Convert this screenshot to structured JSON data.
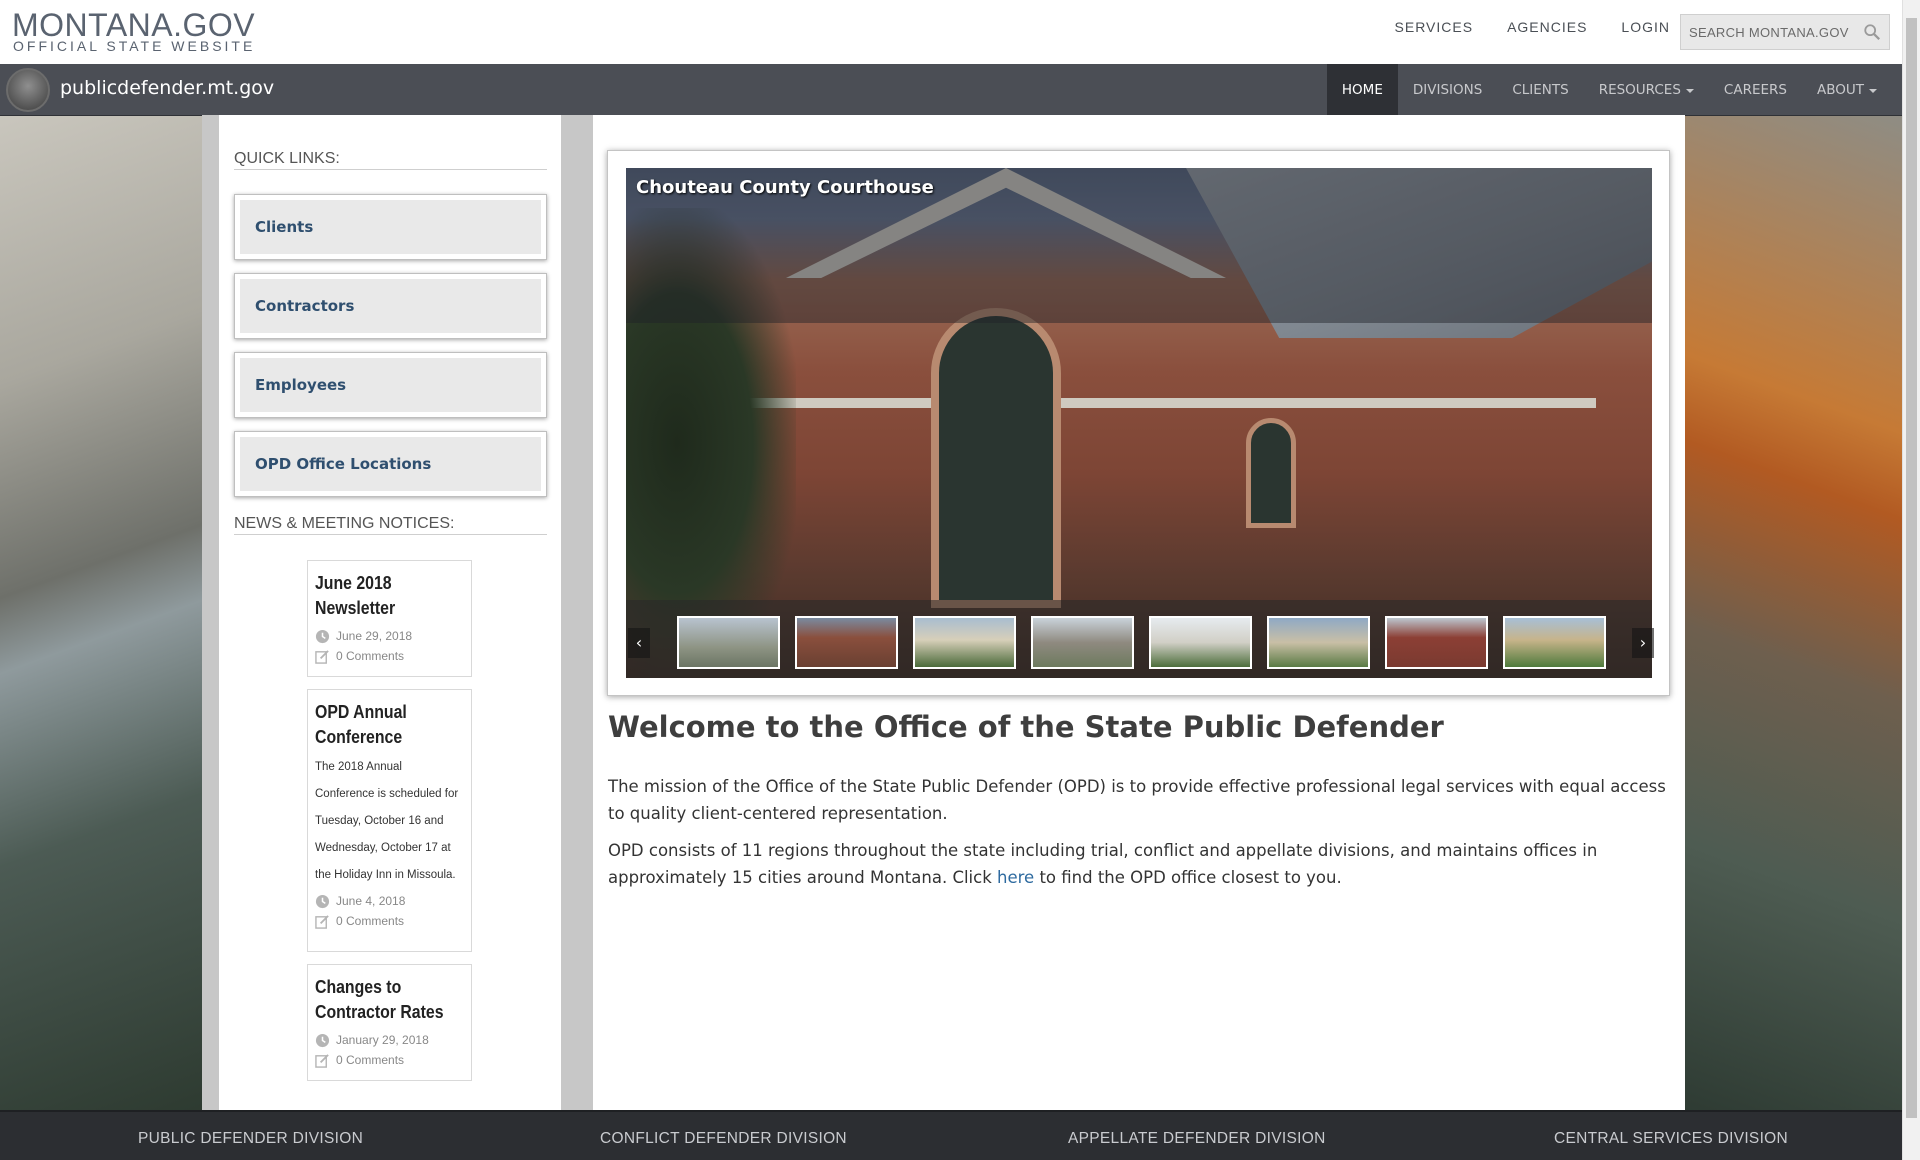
{
  "site": {
    "logo_main": "MONTANA.GOV",
    "logo_sub": "OFFICIAL STATE WEBSITE",
    "top_nav": [
      "SERVICES",
      "AGENCIES",
      "LOGIN"
    ],
    "search_placeholder": "SEARCH MONTANA.GOV"
  },
  "agency": {
    "name": "publicdefender.mt.gov",
    "nav": [
      {
        "label": "HOME",
        "active": true
      },
      {
        "label": "DIVISIONS"
      },
      {
        "label": "CLIENTS"
      },
      {
        "label": "RESOURCES",
        "dropdown": true
      },
      {
        "label": "CAREERS"
      },
      {
        "label": "ABOUT",
        "dropdown": true
      }
    ]
  },
  "sidebar": {
    "quick_links_title": "QUICK LINKS:",
    "quick_links": [
      "Clients",
      "Contractors",
      "Employees",
      "OPD Office Locations"
    ],
    "news_title": "NEWS & MEETING NOTICES:",
    "news": [
      {
        "title_line1": "June 2018",
        "title_line2": "Newsletter",
        "body": "",
        "date": "June 29, 2018",
        "comments": "0 Comments"
      },
      {
        "title_line1": "OPD Annual",
        "title_line2": "Conference",
        "body": "The 2018 Annual Conference is scheduled for Tuesday, October 16 and Wednesday, October 17 at the Holiday Inn in Missoula.",
        "date": "June 4, 2018",
        "comments": "0 Comments"
      },
      {
        "title_line1": "Changes to",
        "title_line2": "Contractor Rates",
        "body": "",
        "date": "January 29, 2018",
        "comments": "0 Comments"
      }
    ]
  },
  "slider": {
    "caption": "Chouteau County Courthouse",
    "thumbnail_count": 8,
    "prev_icon": "chevron-left-icon",
    "next_icon": "chevron-right-icon"
  },
  "main": {
    "title": "Welcome to the Office of the State Public Defender",
    "para1": "The mission of the Office of the State Public Defender (OPD) is to provide effective professional legal services with equal access to quality client-centered representation.",
    "para2_before": "OPD consists of 11 regions throughout the state including trial, conflict and appellate divisions, and maintains offices in approximately 15 cities around Montana. Click ",
    "para2_link": "here",
    "para2_after": " to find the OPD office closest to you."
  },
  "footer": {
    "columns": [
      "PUBLIC DEFENDER DIVISION",
      "CONFLICT DEFENDER DIVISION",
      "APPELLATE DEFENDER DIVISION",
      "CENTRAL SERVICES DIVISION"
    ]
  },
  "colors": {
    "agency_bar": "#4b4e55",
    "active_nav": "#2e3035",
    "link": "#2d6a9f",
    "quick_link_text": "#2f4f6f",
    "footer": "#2c2e32"
  }
}
